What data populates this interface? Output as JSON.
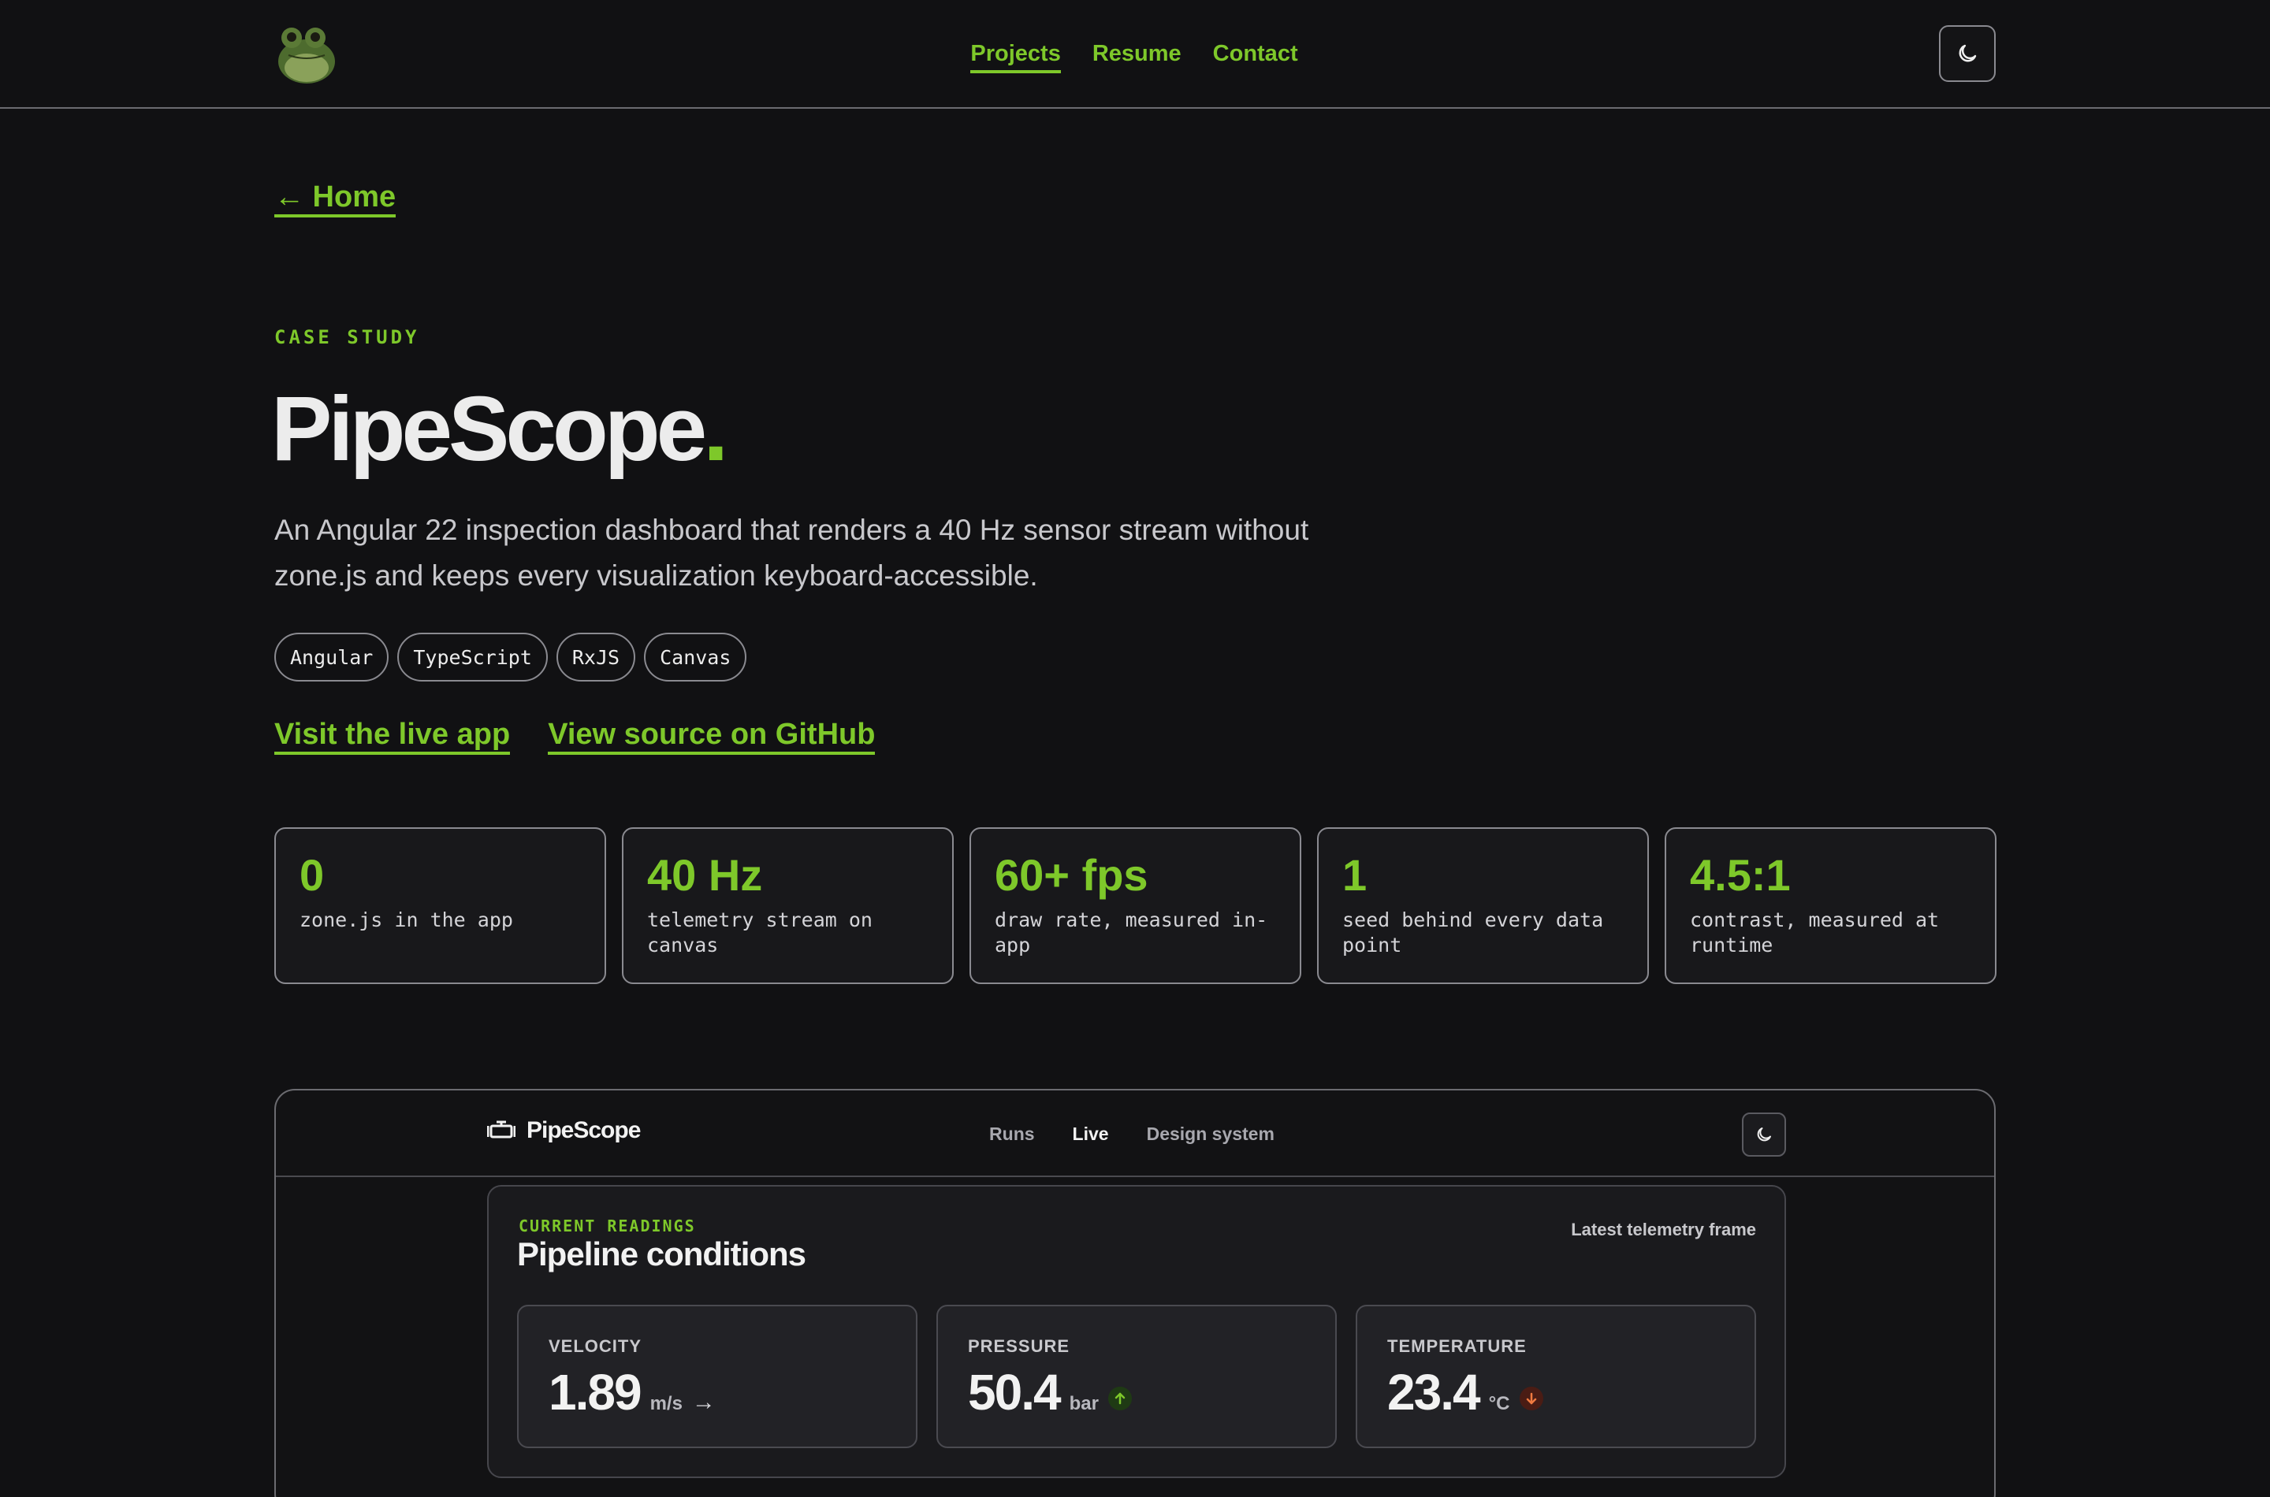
{
  "nav": {
    "items": [
      {
        "label": "Projects",
        "active": true
      },
      {
        "label": "Resume",
        "active": false
      },
      {
        "label": "Contact",
        "active": false
      }
    ],
    "theme_toggle_icon": "moon-icon"
  },
  "page": {
    "back_link": "← Home",
    "eyebrow": "CASE STUDY",
    "title": "PipeScope",
    "title_dot": ".",
    "lede": "An Angular 22 inspection dashboard that renders a 40 Hz sensor stream without zone.js and keeps every visualization keyboard-accessible.",
    "tags": [
      "Angular",
      "TypeScript",
      "RxJS",
      "Canvas"
    ],
    "links": {
      "live_app": "Visit the live app",
      "source": "View source on GitHub"
    },
    "stats": [
      {
        "value": "0",
        "label": "zone.js in the app"
      },
      {
        "value": "40 Hz",
        "label": "telemetry stream on canvas"
      },
      {
        "value": "60+ fps",
        "label": "draw rate, measured in-app"
      },
      {
        "value": "1",
        "label": "seed behind every data point"
      },
      {
        "value": "4.5:1",
        "label": "contrast, measured at runtime"
      }
    ]
  },
  "preview": {
    "brand": "PipeScope",
    "nav": [
      {
        "label": "Runs",
        "active": false
      },
      {
        "label": "Live",
        "active": true
      },
      {
        "label": "Design system",
        "active": false
      }
    ],
    "panel": {
      "eyebrow": "CURRENT READINGS",
      "title": "Pipeline conditions",
      "meta": "Latest telemetry frame",
      "readings": [
        {
          "label": "VELOCITY",
          "value": "1.89",
          "unit": "m/s",
          "trend": "→",
          "trend_icon": "arrow-right-icon"
        },
        {
          "label": "PRESSURE",
          "value": "50.4",
          "unit": "bar",
          "trend_icon": "arrow-up-icon"
        },
        {
          "label": "TEMPERATURE",
          "value": "23.4",
          "unit": "°C",
          "trend_icon": "arrow-down-icon"
        }
      ]
    }
  },
  "colors": {
    "accent": "#7ec82a",
    "background": "#111113",
    "trend_up": "#7ec82a",
    "trend_down": "#e0502a"
  }
}
